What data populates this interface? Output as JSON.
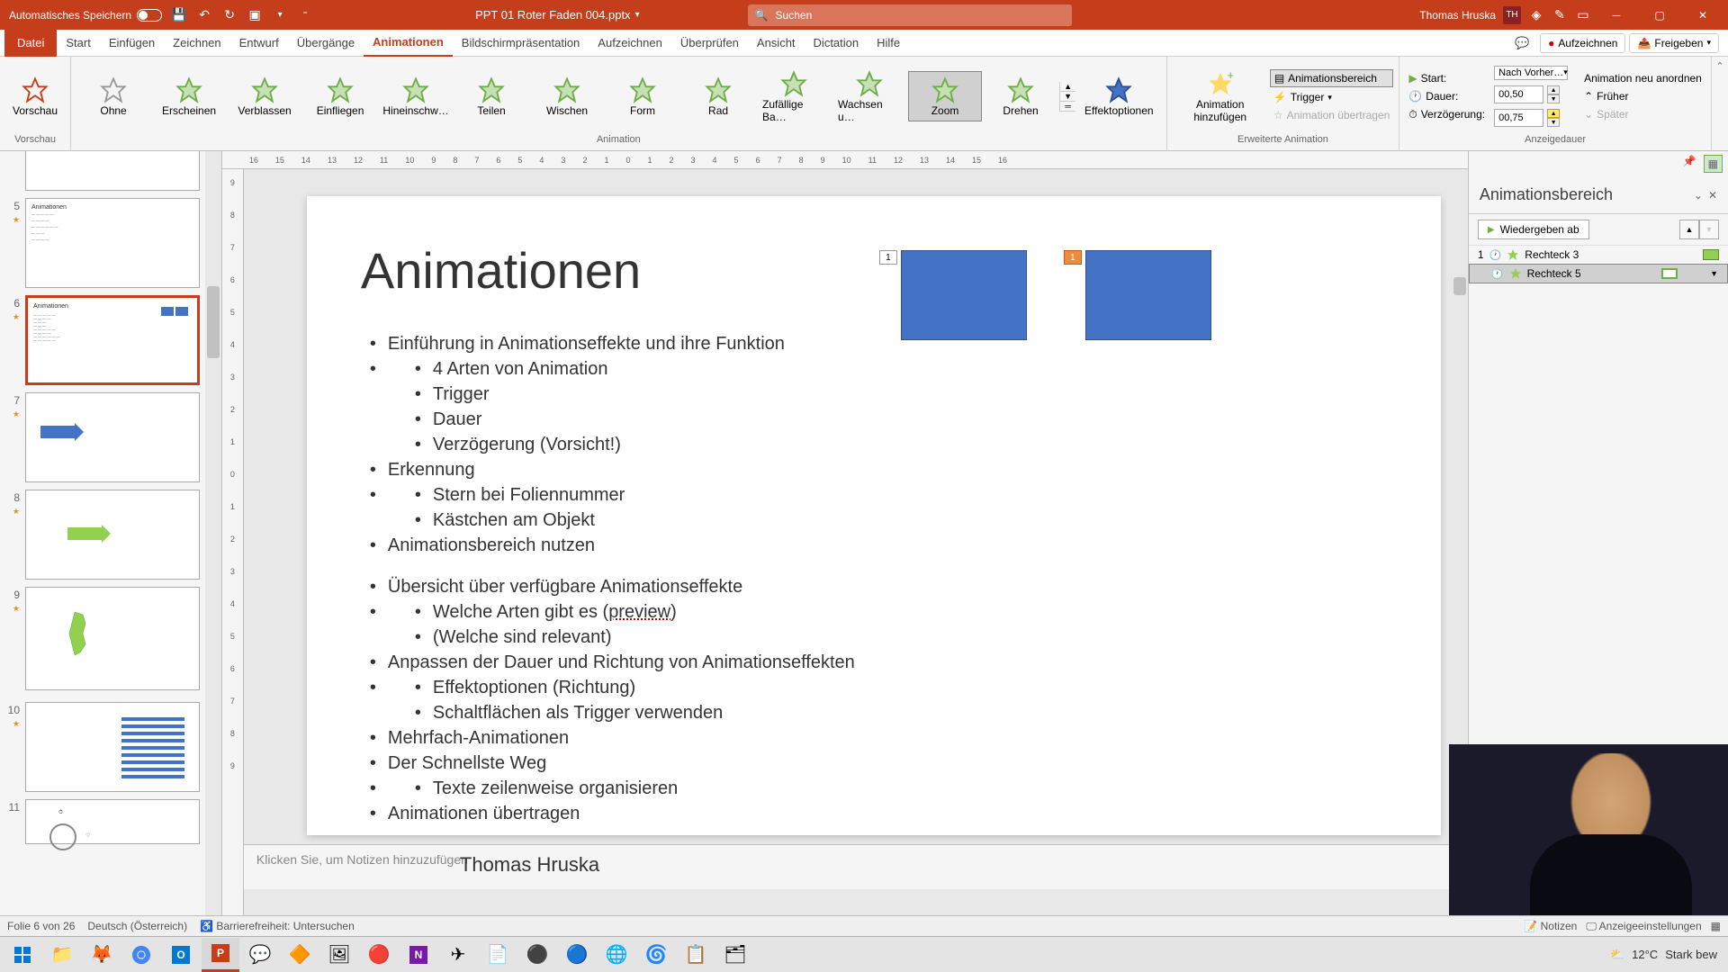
{
  "titlebar": {
    "autosave": "Automatisches Speichern",
    "filename": "PPT 01 Roter Faden 004.pptx",
    "search_placeholder": "Suchen",
    "username": "Thomas Hruska",
    "initials": "TH"
  },
  "tabs": {
    "file": "Datei",
    "start": "Start",
    "einfuegen": "Einfügen",
    "zeichnen": "Zeichnen",
    "entwurf": "Entwurf",
    "uebergaenge": "Übergänge",
    "animationen": "Animationen",
    "bildschirm": "Bildschirmpräsentation",
    "aufzeichnen": "Aufzeichnen",
    "ueberpruefen": "Überprüfen",
    "ansicht": "Ansicht",
    "dictation": "Dictation",
    "hilfe": "Hilfe"
  },
  "ribbon_right": {
    "aufzeichnen": "Aufzeichnen",
    "freigeben": "Freigeben"
  },
  "ribbon": {
    "vorschau": "Vorschau",
    "vorschau_label": "Vorschau",
    "animations": {
      "ohne": "Ohne",
      "erscheinen": "Erscheinen",
      "verblassen": "Verblassen",
      "einfliegen": "Einfliegen",
      "hineinschweben": "Hineinschw…",
      "teilen": "Teilen",
      "wischen": "Wischen",
      "form": "Form",
      "rad": "Rad",
      "zufaellige": "Zufällige Ba…",
      "wachsen": "Wachsen u…",
      "zoom": "Zoom",
      "drehen": "Drehen"
    },
    "animation_label": "Animation",
    "effektoptionen": "Effektoptionen",
    "animation_hinzufuegen": "Animation hinzufügen",
    "animationsbereich": "Animationsbereich",
    "trigger": "Trigger",
    "animation_uebertragen": "Animation übertragen",
    "erweiterte_label": "Erweiterte Animation",
    "timing": {
      "start_label": "Start:",
      "start_value": "Nach Vorher…",
      "dauer_label": "Dauer:",
      "dauer_value": "00,50",
      "verzoegerung_label": "Verzögerung:",
      "verzoegerung_value": "00,75",
      "neu_anordnen": "Animation neu anordnen",
      "frueher": "Früher",
      "spaeter": "Später",
      "anzeigedauer_label": "Anzeigedauer"
    }
  },
  "ruler_marks": [
    "16",
    "15",
    "14",
    "13",
    "12",
    "11",
    "10",
    "9",
    "8",
    "7",
    "6",
    "5",
    "4",
    "3",
    "2",
    "1",
    "0",
    "1",
    "2",
    "3",
    "4",
    "5",
    "6",
    "7",
    "8",
    "9",
    "10",
    "11",
    "12",
    "13",
    "14",
    "15",
    "16"
  ],
  "ruler_v": [
    "9",
    "8",
    "7",
    "6",
    "5",
    "4",
    "3",
    "2",
    "1",
    "0",
    "1",
    "2",
    "3",
    "4",
    "5",
    "6",
    "7",
    "8",
    "9"
  ],
  "thumbnails": [
    {
      "num": "5"
    },
    {
      "num": "6",
      "selected": true,
      "title": "Animationen"
    },
    {
      "num": "7"
    },
    {
      "num": "8"
    },
    {
      "num": "9"
    },
    {
      "num": "10"
    },
    {
      "num": "11"
    }
  ],
  "slide": {
    "title": "Animationen",
    "b1": "Einführung in Animationseffekte und ihre Funktion",
    "b1a": "4 Arten von Animation",
    "b1b": "Trigger",
    "b1c": "Dauer",
    "b1d": "Verzögerung (Vorsicht!)",
    "b2": "Erkennung",
    "b2a": "Stern bei Foliennummer",
    "b2b": "Kästchen am Objekt",
    "b3": "Animationsbereich nutzen",
    "b4": "Übersicht über verfügbare Animationseffekte",
    "b4a_pre": "Welche Arten gibt es (",
    "b4a_link": "preview",
    "b4a_post": ")",
    "b4b": "(Welche sind relevant)",
    "b5": "Anpassen der Dauer und Richtung von Animationseffekten",
    "b5a": "Effektoptionen (Richtung)",
    "b5b": "Schaltflächen als Trigger verwenden",
    "b6": "Mehrfach-Animationen",
    "b7": "Der Schnellste Weg",
    "b7a": "Texte zeilenweise organisieren",
    "b8": "Animationen übertragen",
    "author": "Thomas Hruska",
    "tag1": "1",
    "tag2": "1"
  },
  "notes_placeholder": "Klicken Sie, um Notizen hinzuzufügen",
  "pane": {
    "title": "Animationsbereich",
    "play": "Wiedergeben ab",
    "item1_num": "1",
    "item1_name": "Rechteck 3",
    "item2_name": "Rechteck 5"
  },
  "statusbar": {
    "slide_info": "Folie 6 von 26",
    "language": "Deutsch (Österreich)",
    "accessibility": "Barrierefreiheit: Untersuchen",
    "notizen": "Notizen",
    "anzeige": "Anzeigeeinstellungen"
  },
  "tray": {
    "temp": "12°C",
    "weather": "Stark bew"
  }
}
